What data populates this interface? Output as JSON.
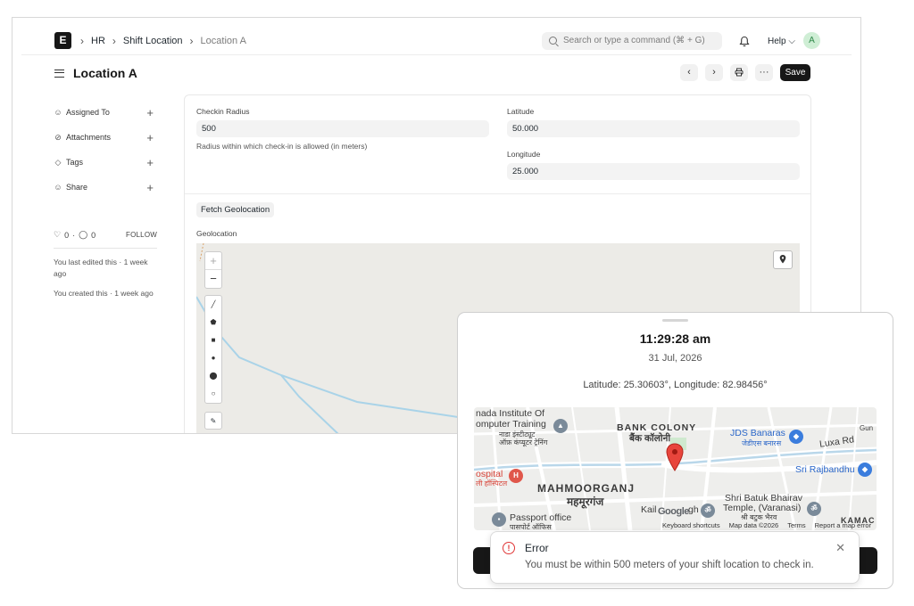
{
  "app": {
    "logo_letter": "E"
  },
  "breadcrumb": [
    "HR",
    "Shift Location",
    "Location A"
  ],
  "search": {
    "placeholder": "Search or type a command (⌘ + G)"
  },
  "header": {
    "help_label": "Help",
    "avatar_initial": "A"
  },
  "page": {
    "title": "Location A",
    "save_label": "Save"
  },
  "sidebar": {
    "items": [
      {
        "label": "Assigned To",
        "icon": "user-icon"
      },
      {
        "label": "Attachments",
        "icon": "paperclip-icon"
      },
      {
        "label": "Tags",
        "icon": "tag-icon"
      },
      {
        "label": "Share",
        "icon": "share-user-icon"
      }
    ],
    "likes": "0",
    "comments": "0",
    "follow_label": "FOLLOW",
    "last_edited": "You last edited this · 1 week ago",
    "created": "You created this · 1 week ago"
  },
  "form": {
    "checkin_radius_label": "Checkin Radius",
    "checkin_radius_value": "500",
    "checkin_radius_desc": "Radius within which check-in is allowed (in meters)",
    "latitude_label": "Latitude",
    "latitude_value": "50.000",
    "longitude_label": "Longitude",
    "longitude_value": "25.000",
    "fetch_label": "Fetch Geolocation",
    "geolocation_label": "Geolocation"
  },
  "checkin": {
    "time": "11:29:28 am",
    "date": "31 Jul, 2026",
    "coords": "Latitude: 25.30603°, Longitude: 82.98456°"
  },
  "gmap": {
    "labels": {
      "inst1": "nada Institute Of",
      "inst2": "omputer Training",
      "inst3": "नाडा इंस्टीट्यूट",
      "inst4": "ऑफ़ कंप्यूटर ट्रेनिंग",
      "bank": "BANK COLONY",
      "bank_hi": "बैंक कॉलोनी",
      "jds": "JDS Banaras",
      "jds_hi": "जेडीएस बनारस",
      "luxa": "Luxa Rd",
      "gun": "Gun",
      "ospital": "ospital",
      "hospital_hi": "ली हॉस्पिटल",
      "mahmoor": "MAHMOORGANJ",
      "mahmoor_hi": "महमूरगंज",
      "raj": "Sri Rajbandhu",
      "batuk1": "Shri Batuk Bhairav",
      "batuk2": "Temple, (Varanasi)",
      "batuk_hi": "श्री बटुक भैरव",
      "kail": "Kail",
      "gh": "gh",
      "kamac": "KAMAC",
      "passport": "Passport office",
      "passport_hi": "पासपोर्ट ऑफिस",
      "google": "Google"
    },
    "attribution": [
      "Keyboard shortcuts",
      "Map data ©2026",
      "Terms",
      "Report a map error"
    ]
  },
  "toast": {
    "title": "Error",
    "message": "You must be within 500 meters of your shift location to check in."
  },
  "colors": {
    "primary": "#171717",
    "error": "#e03636",
    "pin": "#e8453c",
    "route": "#a9d3e8"
  }
}
